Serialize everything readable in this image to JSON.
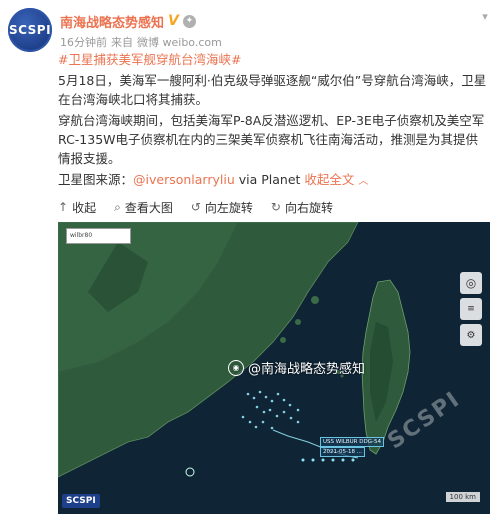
{
  "account": {
    "avatar_text": "SCSPI",
    "name": "南海战略态势感知",
    "verified_badge": "V",
    "meta_time": "16分钟前",
    "meta_from": "来自",
    "meta_source": "微博 weibo.com"
  },
  "post": {
    "topic": "#卫星捕获美军舰穿航台湾海峡#",
    "paragraph_1": "5月18日，美海军一艘阿利·伯克级导弹驱逐舰“威尔伯”号穿航台湾海峡，卫星在台湾海峡北口将其捕获。",
    "paragraph_2": "穿航台湾海峡期间，包括美海军P-8A反潜巡逻机、EP-3E电子侦察机及美空军RC-135W电子侦察机在内的三架美军侦察机飞往南海活动，推测是为其提供情报支援。",
    "source_prefix": "卫星图来源：",
    "source_user": "@iversonlarryliu",
    "source_via": " via Planet ",
    "collapse_label": "收起全文"
  },
  "toolbar": {
    "collapse": "收起",
    "view_large": "查看大图",
    "rotate_left": "向左旋转",
    "rotate_right": "向右旋转"
  },
  "map": {
    "search_text": "wilbr80",
    "watermark_text": "@南海战略态势感知",
    "watermark_brand": "SCSPI",
    "mini_logo": "SCSPI",
    "ship_label_1": "USS WILBUR DDG-54",
    "ship_label_2": "2021-05-18 ...",
    "scale_text": "100 km",
    "colors": {
      "sea": "#0f2434",
      "land": "#2f5a3c",
      "track": "#8fe3f5"
    }
  },
  "icons": {
    "verified": "verified-v-icon",
    "member": "member-icon",
    "chevron": "chevron-down-icon",
    "collapse": "collapse-up-icon",
    "zoom": "magnifier-icon",
    "rotate_left": "rotate-left-icon",
    "rotate_right": "rotate-right-icon"
  }
}
